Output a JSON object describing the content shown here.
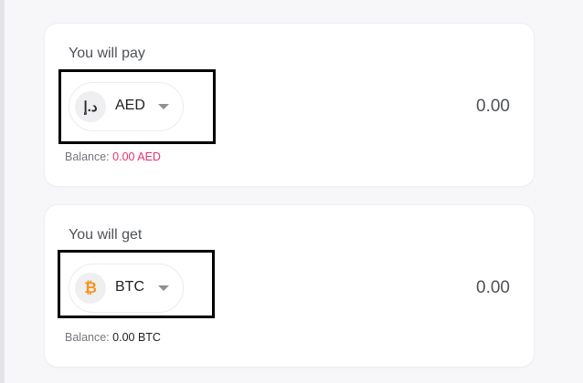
{
  "pay_card": {
    "title": "You will pay",
    "currency": {
      "ticker": "AED",
      "icon_glyph": "د.إ",
      "icon_name": "aed-currency-icon"
    },
    "amount": "0.00",
    "balance_label": "Balance:",
    "balance_value": "0.00 AED",
    "balance_color": "#e5336c"
  },
  "get_card": {
    "title": "You will get",
    "currency": {
      "ticker": "BTC",
      "icon_glyph": "₿",
      "icon_name": "bitcoin-icon"
    },
    "amount": "0.00",
    "balance_label": "Balance:",
    "balance_value": "0.00 BTC"
  },
  "colors": {
    "bitcoin_orange": "#f7931a",
    "negative_balance": "#e5336c"
  }
}
